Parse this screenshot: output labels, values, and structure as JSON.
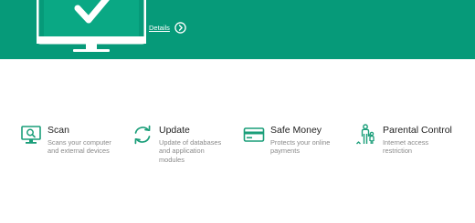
{
  "colors": {
    "accent": "#069a79",
    "icon": "#1a9e79",
    "title": "#222222",
    "description": "#8a8a8a"
  },
  "header": {
    "monitor_icon": "monitor-check-icon",
    "details_label": "Details",
    "details_icon": "chevron-right-circle-icon"
  },
  "tools": [
    {
      "icon": "scan-monitor-icon",
      "title": "Scan",
      "description": [
        "Scans your computer",
        "and external devices"
      ]
    },
    {
      "icon": "update-arrows-icon",
      "title": "Update",
      "description": [
        "Update of databases",
        "and application",
        "modules"
      ]
    },
    {
      "icon": "credit-card-icon",
      "title": "Safe Money",
      "description": [
        "Protects your online",
        "payments"
      ]
    },
    {
      "icon": "family-icon",
      "title": "Parental Control",
      "description": [
        "Internet access",
        "restriction"
      ]
    }
  ]
}
